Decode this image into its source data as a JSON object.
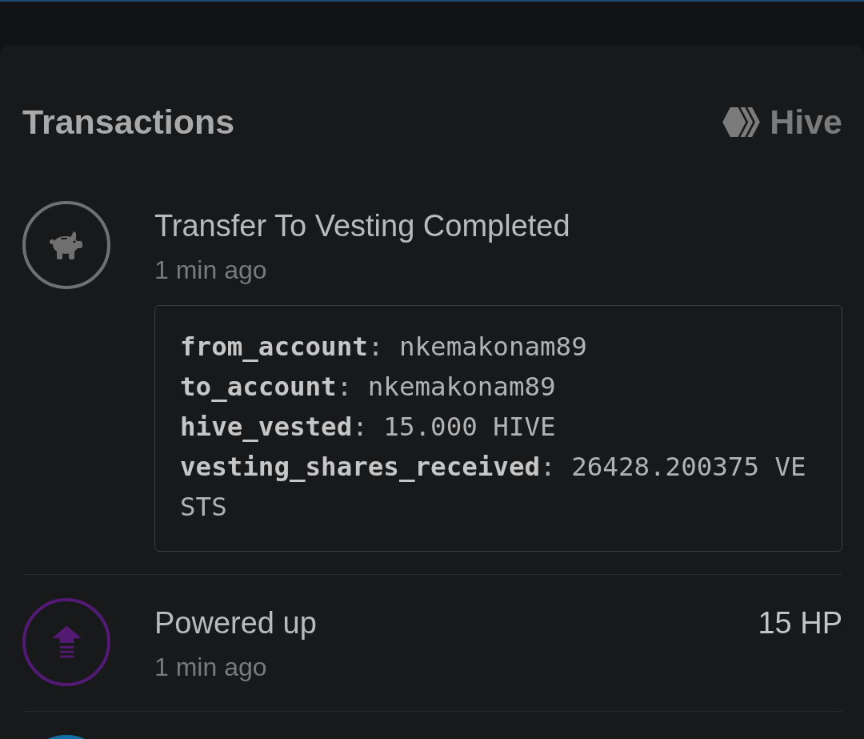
{
  "card": {
    "title": "Transactions",
    "network": {
      "label": "Hive"
    }
  },
  "transactions": [
    {
      "kind": "vesting",
      "color": "#707070",
      "title": "Transfer To Vesting Completed",
      "time": "1 min ago",
      "details": [
        "**from_account**: nkemakonam89",
        "**to_account**: nkemakonam89",
        "**hive_vested**: 15.000 HIVE",
        "**vesting_shares_received**: 26428.200375 VESTS"
      ]
    },
    {
      "kind": "power_up",
      "color": "#521a73",
      "title": "Powered up",
      "time": "1 min ago",
      "amount": "15 HP"
    },
    {
      "color": "#1170a8"
    }
  ]
}
